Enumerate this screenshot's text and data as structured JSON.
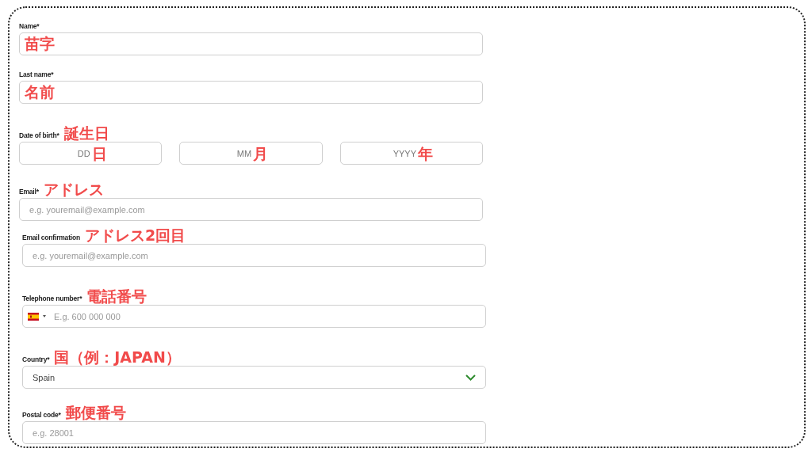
{
  "form": {
    "fields": [
      {
        "kind": "text",
        "label": "Name*",
        "value": "苗字"
      },
      {
        "kind": "text",
        "label": "Last name*",
        "value": "名前"
      },
      {
        "kind": "date",
        "label": "Date of birth*",
        "annotation": "誕生日",
        "parts": [
          {
            "placeholder": "DD",
            "annotation": "日"
          },
          {
            "placeholder": "MM",
            "annotation": "月"
          },
          {
            "placeholder": "YYYY",
            "annotation": "年"
          }
        ]
      },
      {
        "kind": "text",
        "label": "Email*",
        "annotation": "アドレス",
        "placeholder": "e.g. youremail@example.com"
      },
      {
        "kind": "text",
        "label": "Email confirmation",
        "annotation": "アドレス2回目",
        "placeholder": "e.g. youremail@example.com"
      },
      {
        "kind": "phone",
        "label": "Telephone number*",
        "annotation": "電話番号",
        "placeholder": "E.g. 600 000 000"
      },
      {
        "kind": "select",
        "label": "Country*",
        "annotation": "国（例：JAPAN）",
        "value": "Spain"
      },
      {
        "kind": "text",
        "label": "Postal code*",
        "annotation": "郵便番号",
        "placeholder": "e.g. 28001"
      }
    ]
  }
}
